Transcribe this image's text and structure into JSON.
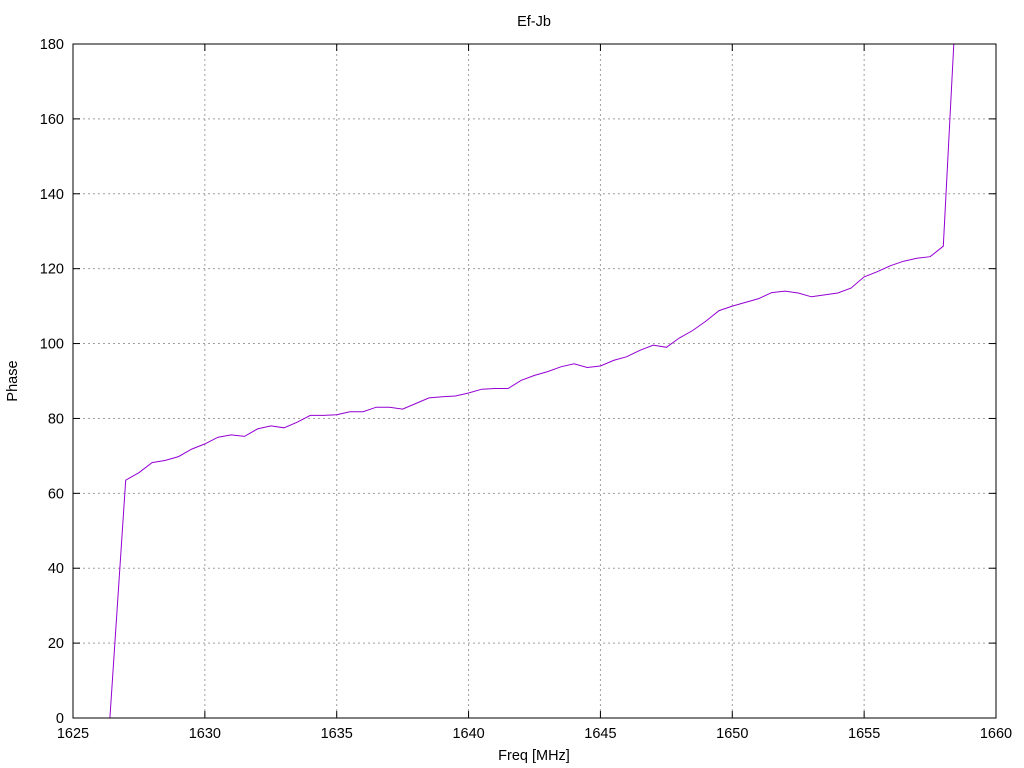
{
  "chart_data": {
    "type": "line",
    "title": "Ef-Jb",
    "xlabel": "Freq [MHz]",
    "ylabel": "Phase",
    "xlim": [
      1625,
      1660
    ],
    "ylim": [
      0,
      180
    ],
    "xticks": [
      1625,
      1630,
      1635,
      1640,
      1645,
      1650,
      1655,
      1660
    ],
    "yticks": [
      0,
      20,
      40,
      60,
      80,
      100,
      120,
      140,
      160,
      180
    ],
    "grid": true,
    "series": [
      {
        "color": "#9400d3",
        "x": [
          1626.4,
          1627.0,
          1627.5,
          1628.0,
          1628.5,
          1629.0,
          1629.5,
          1630.0,
          1630.5,
          1631.0,
          1631.5,
          1632.0,
          1632.5,
          1633.0,
          1633.5,
          1634.0,
          1634.5,
          1635.0,
          1635.5,
          1636.0,
          1636.5,
          1637.0,
          1637.5,
          1638.0,
          1638.5,
          1639.0,
          1639.5,
          1640.0,
          1640.5,
          1641.0,
          1641.5,
          1642.0,
          1642.5,
          1643.0,
          1643.5,
          1644.0,
          1644.5,
          1645.0,
          1645.5,
          1646.0,
          1646.5,
          1647.0,
          1647.5,
          1648.0,
          1648.5,
          1649.0,
          1649.5,
          1650.0,
          1650.5,
          1651.0,
          1651.5,
          1652.0,
          1652.5,
          1653.0,
          1653.5,
          1654.0,
          1654.5,
          1655.0,
          1655.5,
          1656.0,
          1656.5,
          1657.0,
          1657.5,
          1658.0,
          1658.4
        ],
        "y": [
          0,
          63.5,
          65.5,
          68.2,
          68.8,
          69.8,
          71.8,
          73.2,
          75.0,
          75.6,
          75.2,
          77.2,
          78.0,
          77.5,
          79.0,
          80.8,
          80.8,
          81.0,
          81.8,
          81.8,
          83.0,
          83.0,
          82.5,
          84.0,
          85.5,
          85.8,
          86.0,
          86.8,
          87.8,
          88.0,
          88.0,
          90.2,
          91.5,
          92.5,
          93.8,
          94.6,
          93.6,
          94.0,
          95.5,
          96.5,
          98.2,
          99.6,
          99.0,
          101.5,
          103.5,
          106.0,
          108.8,
          110.0,
          111.0,
          112.0,
          113.6,
          114.0,
          113.5,
          112.5,
          113.0,
          113.5,
          114.8,
          117.8,
          119.2,
          120.8,
          122.0,
          122.8,
          123.2,
          126.0,
          180
        ]
      }
    ]
  }
}
